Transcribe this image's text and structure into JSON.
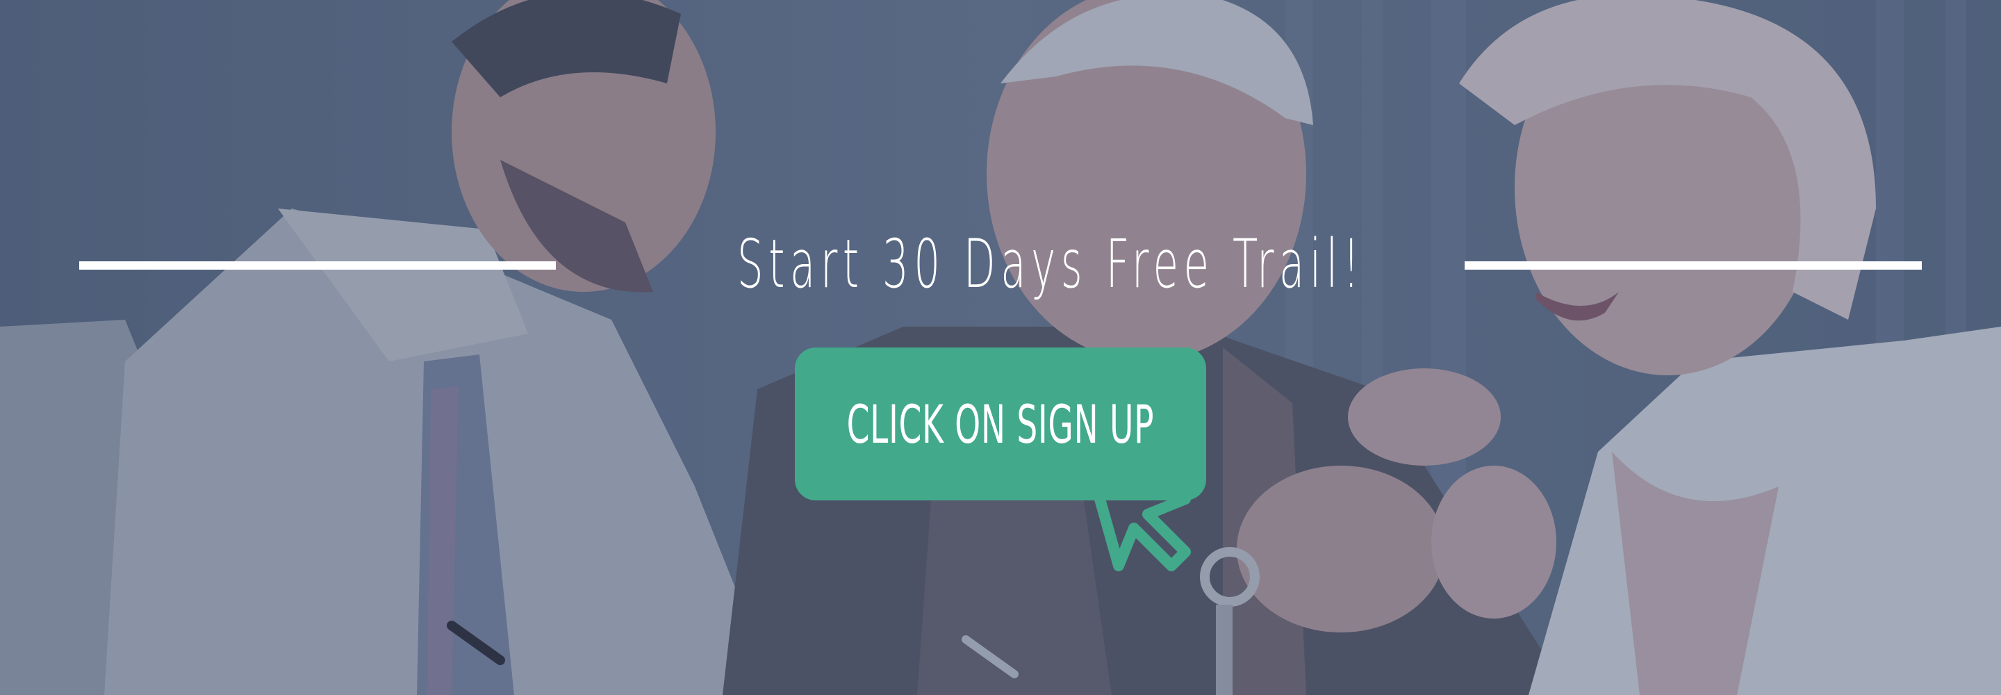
{
  "banner": {
    "headline": "Start 30 Days Free Trail!",
    "cta_label": "CLICK ON SIGN UP",
    "cta_icon": "cursor-arrow-icon",
    "photo": "three-people-meeting-photo"
  },
  "colors": {
    "accent": "#43a98b",
    "overlay": "#4a5a72",
    "text": "#ffffff"
  }
}
